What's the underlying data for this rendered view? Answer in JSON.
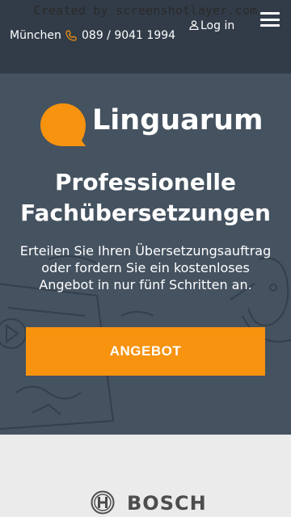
{
  "watermark": "Created by screenshotlayer.com",
  "topbar": {
    "city": "München",
    "phone": "089 / 9041 1994",
    "login_label": "Log in"
  },
  "hero": {
    "brand": "Linguarum",
    "headline_line1": "Professionelle",
    "headline_line2": "Fachübersetzungen",
    "subtext": "Erteilen Sie Ihren Übersetzungsauftrag oder fordern Sie ein kostenloses Angebot in nur fünf Schritten an.",
    "cta_label": "ANGEBOT"
  },
  "clients": {
    "logo_text": "BOSCH"
  },
  "colors": {
    "topbar_bg": "#323c48",
    "hero_bg": "#455260",
    "accent": "#f7930f",
    "clients_bg": "#ebebeb"
  }
}
